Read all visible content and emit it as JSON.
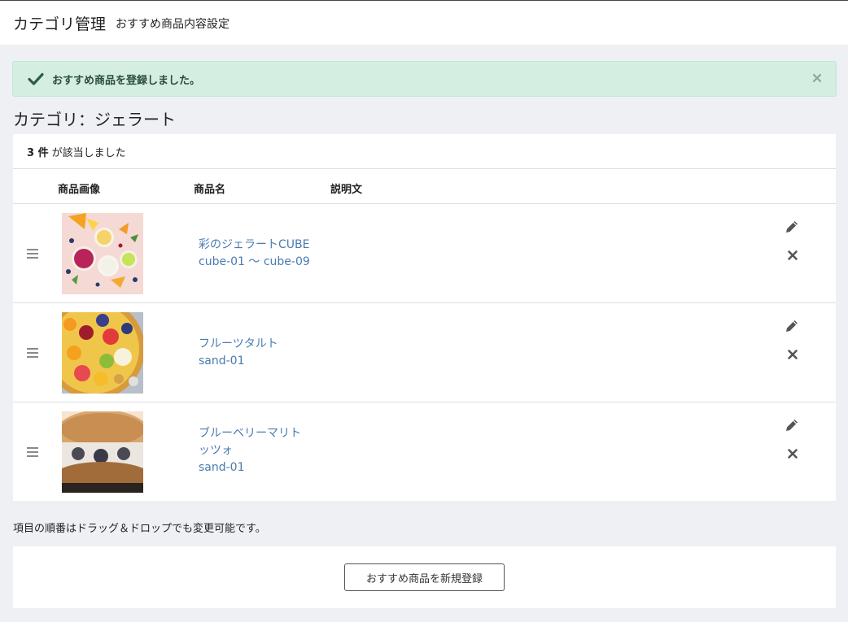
{
  "header": {
    "title": "カテゴリ管理",
    "subtitle": "おすすめ商品内容設定"
  },
  "alert": {
    "message": "おすすめ商品を登録しました。",
    "icon": "check-icon",
    "color": "#d4eee2"
  },
  "category": {
    "title": "カテゴリ：ジェラート"
  },
  "results": {
    "count": "3 件",
    "suffix": "が該当しました"
  },
  "table": {
    "headers": {
      "image": "商品画像",
      "name": "商品名",
      "description": "説明文"
    },
    "rows": [
      {
        "name_lines": [
          "彩のジェラートCUBE",
          "cube-01 〜 cube-09"
        ],
        "image": "gelato-cups"
      },
      {
        "name_lines": [
          "フルーツタルト",
          "sand-01"
        ],
        "image": "fruit-tart"
      },
      {
        "name_lines": [
          "ブルーベリーマリト",
          "ッツォ",
          "sand-01"
        ],
        "image": "blueberry-maritozzo"
      }
    ]
  },
  "note": "項目の順番はドラッグ＆ドロップでも変更可能です。",
  "footer": {
    "add_label": "おすすめ商品を新規登録"
  },
  "colors": {
    "link": "#4a7bb0",
    "background": "#eef0f4",
    "alert_text": "#2b4d3d"
  }
}
